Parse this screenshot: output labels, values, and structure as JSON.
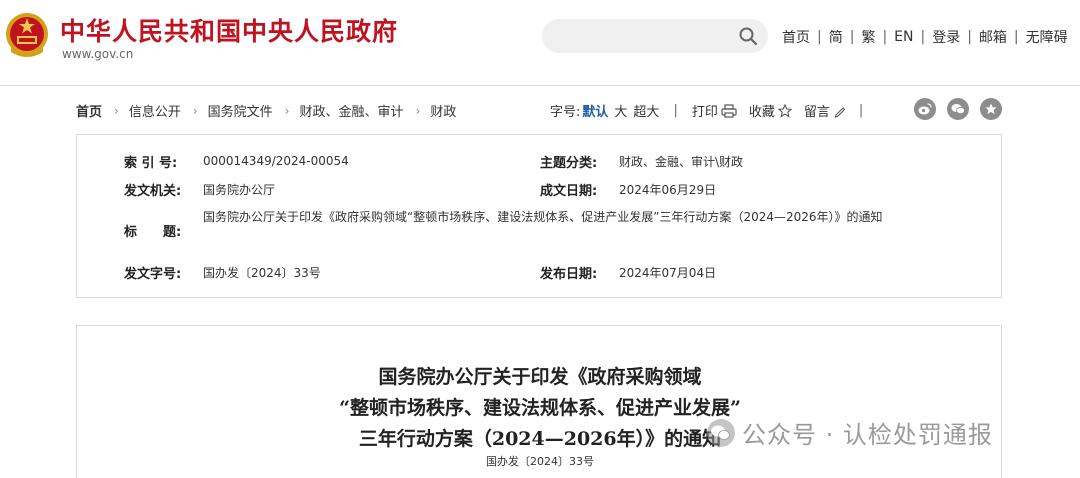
{
  "header": {
    "site_title": "中华人民共和国中央人民政府",
    "site_url": "www.gov.cn",
    "search_placeholder": "",
    "links": [
      "首页",
      "简",
      "繁",
      "EN",
      "登录",
      "邮箱",
      "无障碍"
    ],
    "link_separator": "|"
  },
  "breadcrumb": {
    "items": [
      "首页",
      "信息公开",
      "国务院文件",
      "财政、金融、审计",
      "财政"
    ],
    "arrow": "›"
  },
  "tools": {
    "font_label": "字号:",
    "font_default": "默认",
    "font_large": "大",
    "font_xlarge": "超大",
    "separator": "|",
    "print_label": "打印",
    "favorite_label": "收藏",
    "comment_label": "留言"
  },
  "share_icons": [
    "weibo-icon",
    "wechat-icon",
    "star-icon"
  ],
  "metadata": {
    "index_label": "索 引 号:",
    "index_value": "000014349/2024-00054",
    "category_label": "主题分类:",
    "category_value": "财政、金融、审计\\财政",
    "issuer_label": "发文机关:",
    "issuer_value": "国务院办公厅",
    "date_written_label": "成文日期:",
    "date_written_value": "2024年06月29日",
    "title_label": "标　　题:",
    "title_value": "国务院办公厅关于印发《政府采购领域“整顿市场秩序、建设法规体系、促进产业发展”三年行动方案（2024—2026年）》的通知",
    "doc_no_label": "发文字号:",
    "doc_no_value": "国办发〔2024〕33号",
    "publish_date_label": "发布日期:",
    "publish_date_value": "2024年07月04日"
  },
  "article": {
    "title_line1": "国务院办公厅关于印发《政府采购领域",
    "title_line2": "“整顿市场秩序、建设法规体系、促进产业发展”",
    "title_line3": "三年行动方案（2024—2026年）》的通知",
    "doc_number": "国办发〔2024〕33号"
  },
  "watermark": {
    "text": "公众号 · 认检处罚通报"
  },
  "colors": {
    "brand_red": "#c1121f",
    "accent_blue": "#1f5fa8",
    "icon_gray": "#8d8d8d",
    "border": "#d9d9d9"
  }
}
